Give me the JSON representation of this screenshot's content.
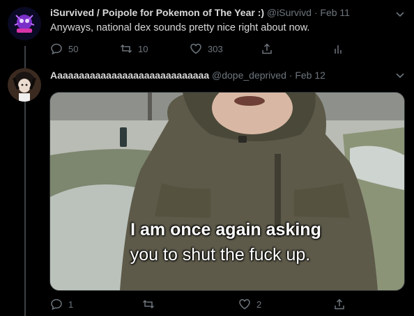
{
  "tweet1": {
    "display_name": "iSurvived / Poipole for Pokemon of The Year :)",
    "handle": "@iSurvivd",
    "separator": "·",
    "date": "Feb 11",
    "text": "Anyways, national dex sounds pretty nice right about now.",
    "replies": "50",
    "retweets": "10",
    "likes": "303"
  },
  "tweet2": {
    "display_name": "Aaaaaaaaaaaaaaaaaaaaaaaaaaaaa",
    "handle": "@dope_deprived",
    "separator": "·",
    "date": "Feb 12",
    "media_caption_line1": "I am once again asking",
    "media_caption_line2": "you to shut the fuck up.",
    "replies": "1",
    "retweets": "",
    "likes": "2"
  },
  "colors": {
    "background": "#000000",
    "primary_text": "#d9d9d9",
    "secondary_text": "#6e767d",
    "thread_line": "#3d4144"
  },
  "icons": {
    "caret": "chevron-down-icon",
    "reply": "reply-icon",
    "retweet": "retweet-icon",
    "like": "heart-icon",
    "share": "share-icon",
    "analytics": "analytics-icon"
  }
}
